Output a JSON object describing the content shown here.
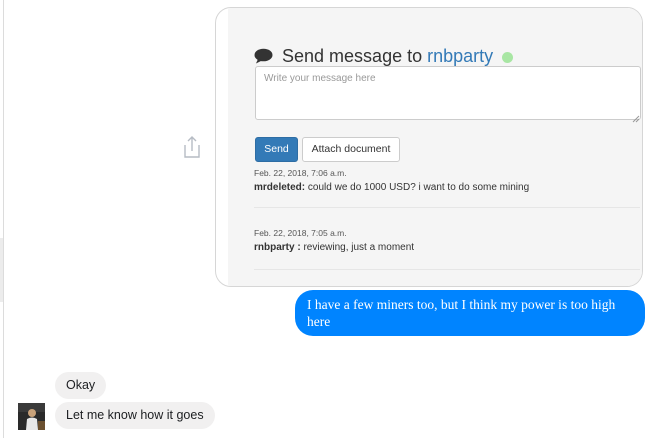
{
  "send_form": {
    "title_prefix": "Send message to",
    "recipient": "rnbparty",
    "recipient_online": true,
    "message_placeholder": "Write your message here",
    "message_value": "",
    "send_label": "Send",
    "attach_label": "Attach document"
  },
  "messages": [
    {
      "date": "Feb. 22, 2018, 7:06 a.m.",
      "author": "mrdeleted:",
      "text": "could we do 1000 USD? i want to do some mining"
    },
    {
      "date": "Feb. 22, 2018, 7:05 a.m.",
      "author": "rnbparty :",
      "text": "reviewing, just a moment"
    }
  ],
  "chat": {
    "outgoing": [
      {
        "text": "I have a few miners too, but I think my power is too high here"
      }
    ],
    "incoming": [
      {
        "text": "Okay"
      },
      {
        "text": "Let me know how it goes"
      }
    ]
  },
  "colors": {
    "outgoing_bubble": "#0084ff",
    "incoming_bubble": "#f1f0f0",
    "primary_button": "#337ab7",
    "recipient_link": "#337ab7",
    "online_status": "#a8e6a3"
  },
  "icons": {
    "share": "share-icon",
    "title": "speech-bubble-icon",
    "status": "online-status-icon"
  }
}
